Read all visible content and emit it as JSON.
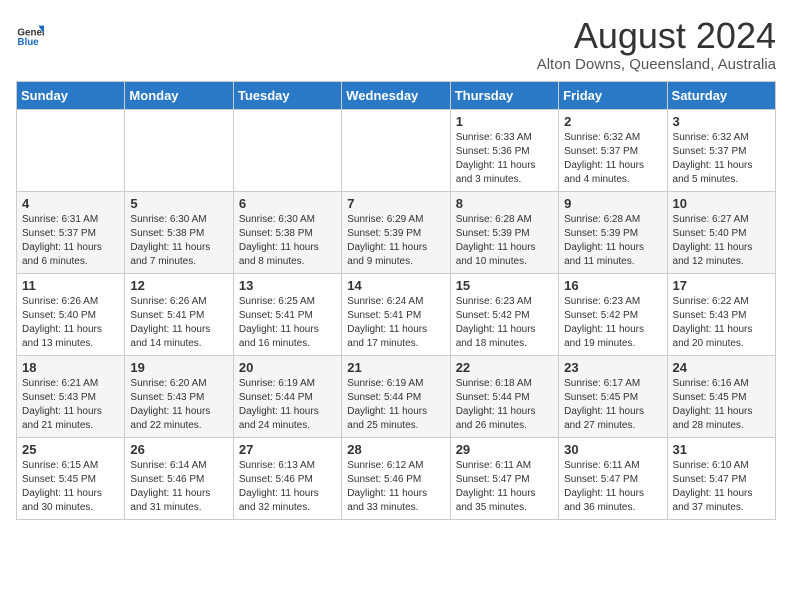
{
  "header": {
    "logo_general": "General",
    "logo_blue": "Blue",
    "title": "August 2024",
    "subtitle": "Alton Downs, Queensland, Australia"
  },
  "days_of_week": [
    "Sunday",
    "Monday",
    "Tuesday",
    "Wednesday",
    "Thursday",
    "Friday",
    "Saturday"
  ],
  "weeks": [
    [
      {
        "day": "",
        "info": ""
      },
      {
        "day": "",
        "info": ""
      },
      {
        "day": "",
        "info": ""
      },
      {
        "day": "",
        "info": ""
      },
      {
        "day": "1",
        "info": "Sunrise: 6:33 AM\nSunset: 5:36 PM\nDaylight: 11 hours\nand 3 minutes."
      },
      {
        "day": "2",
        "info": "Sunrise: 6:32 AM\nSunset: 5:37 PM\nDaylight: 11 hours\nand 4 minutes."
      },
      {
        "day": "3",
        "info": "Sunrise: 6:32 AM\nSunset: 5:37 PM\nDaylight: 11 hours\nand 5 minutes."
      }
    ],
    [
      {
        "day": "4",
        "info": "Sunrise: 6:31 AM\nSunset: 5:37 PM\nDaylight: 11 hours\nand 6 minutes."
      },
      {
        "day": "5",
        "info": "Sunrise: 6:30 AM\nSunset: 5:38 PM\nDaylight: 11 hours\nand 7 minutes."
      },
      {
        "day": "6",
        "info": "Sunrise: 6:30 AM\nSunset: 5:38 PM\nDaylight: 11 hours\nand 8 minutes."
      },
      {
        "day": "7",
        "info": "Sunrise: 6:29 AM\nSunset: 5:39 PM\nDaylight: 11 hours\nand 9 minutes."
      },
      {
        "day": "8",
        "info": "Sunrise: 6:28 AM\nSunset: 5:39 PM\nDaylight: 11 hours\nand 10 minutes."
      },
      {
        "day": "9",
        "info": "Sunrise: 6:28 AM\nSunset: 5:39 PM\nDaylight: 11 hours\nand 11 minutes."
      },
      {
        "day": "10",
        "info": "Sunrise: 6:27 AM\nSunset: 5:40 PM\nDaylight: 11 hours\nand 12 minutes."
      }
    ],
    [
      {
        "day": "11",
        "info": "Sunrise: 6:26 AM\nSunset: 5:40 PM\nDaylight: 11 hours\nand 13 minutes."
      },
      {
        "day": "12",
        "info": "Sunrise: 6:26 AM\nSunset: 5:41 PM\nDaylight: 11 hours\nand 14 minutes."
      },
      {
        "day": "13",
        "info": "Sunrise: 6:25 AM\nSunset: 5:41 PM\nDaylight: 11 hours\nand 16 minutes."
      },
      {
        "day": "14",
        "info": "Sunrise: 6:24 AM\nSunset: 5:41 PM\nDaylight: 11 hours\nand 17 minutes."
      },
      {
        "day": "15",
        "info": "Sunrise: 6:23 AM\nSunset: 5:42 PM\nDaylight: 11 hours\nand 18 minutes."
      },
      {
        "day": "16",
        "info": "Sunrise: 6:23 AM\nSunset: 5:42 PM\nDaylight: 11 hours\nand 19 minutes."
      },
      {
        "day": "17",
        "info": "Sunrise: 6:22 AM\nSunset: 5:43 PM\nDaylight: 11 hours\nand 20 minutes."
      }
    ],
    [
      {
        "day": "18",
        "info": "Sunrise: 6:21 AM\nSunset: 5:43 PM\nDaylight: 11 hours\nand 21 minutes."
      },
      {
        "day": "19",
        "info": "Sunrise: 6:20 AM\nSunset: 5:43 PM\nDaylight: 11 hours\nand 22 minutes."
      },
      {
        "day": "20",
        "info": "Sunrise: 6:19 AM\nSunset: 5:44 PM\nDaylight: 11 hours\nand 24 minutes."
      },
      {
        "day": "21",
        "info": "Sunrise: 6:19 AM\nSunset: 5:44 PM\nDaylight: 11 hours\nand 25 minutes."
      },
      {
        "day": "22",
        "info": "Sunrise: 6:18 AM\nSunset: 5:44 PM\nDaylight: 11 hours\nand 26 minutes."
      },
      {
        "day": "23",
        "info": "Sunrise: 6:17 AM\nSunset: 5:45 PM\nDaylight: 11 hours\nand 27 minutes."
      },
      {
        "day": "24",
        "info": "Sunrise: 6:16 AM\nSunset: 5:45 PM\nDaylight: 11 hours\nand 28 minutes."
      }
    ],
    [
      {
        "day": "25",
        "info": "Sunrise: 6:15 AM\nSunset: 5:45 PM\nDaylight: 11 hours\nand 30 minutes."
      },
      {
        "day": "26",
        "info": "Sunrise: 6:14 AM\nSunset: 5:46 PM\nDaylight: 11 hours\nand 31 minutes."
      },
      {
        "day": "27",
        "info": "Sunrise: 6:13 AM\nSunset: 5:46 PM\nDaylight: 11 hours\nand 32 minutes."
      },
      {
        "day": "28",
        "info": "Sunrise: 6:12 AM\nSunset: 5:46 PM\nDaylight: 11 hours\nand 33 minutes."
      },
      {
        "day": "29",
        "info": "Sunrise: 6:11 AM\nSunset: 5:47 PM\nDaylight: 11 hours\nand 35 minutes."
      },
      {
        "day": "30",
        "info": "Sunrise: 6:11 AM\nSunset: 5:47 PM\nDaylight: 11 hours\nand 36 minutes."
      },
      {
        "day": "31",
        "info": "Sunrise: 6:10 AM\nSunset: 5:47 PM\nDaylight: 11 hours\nand 37 minutes."
      }
    ]
  ]
}
